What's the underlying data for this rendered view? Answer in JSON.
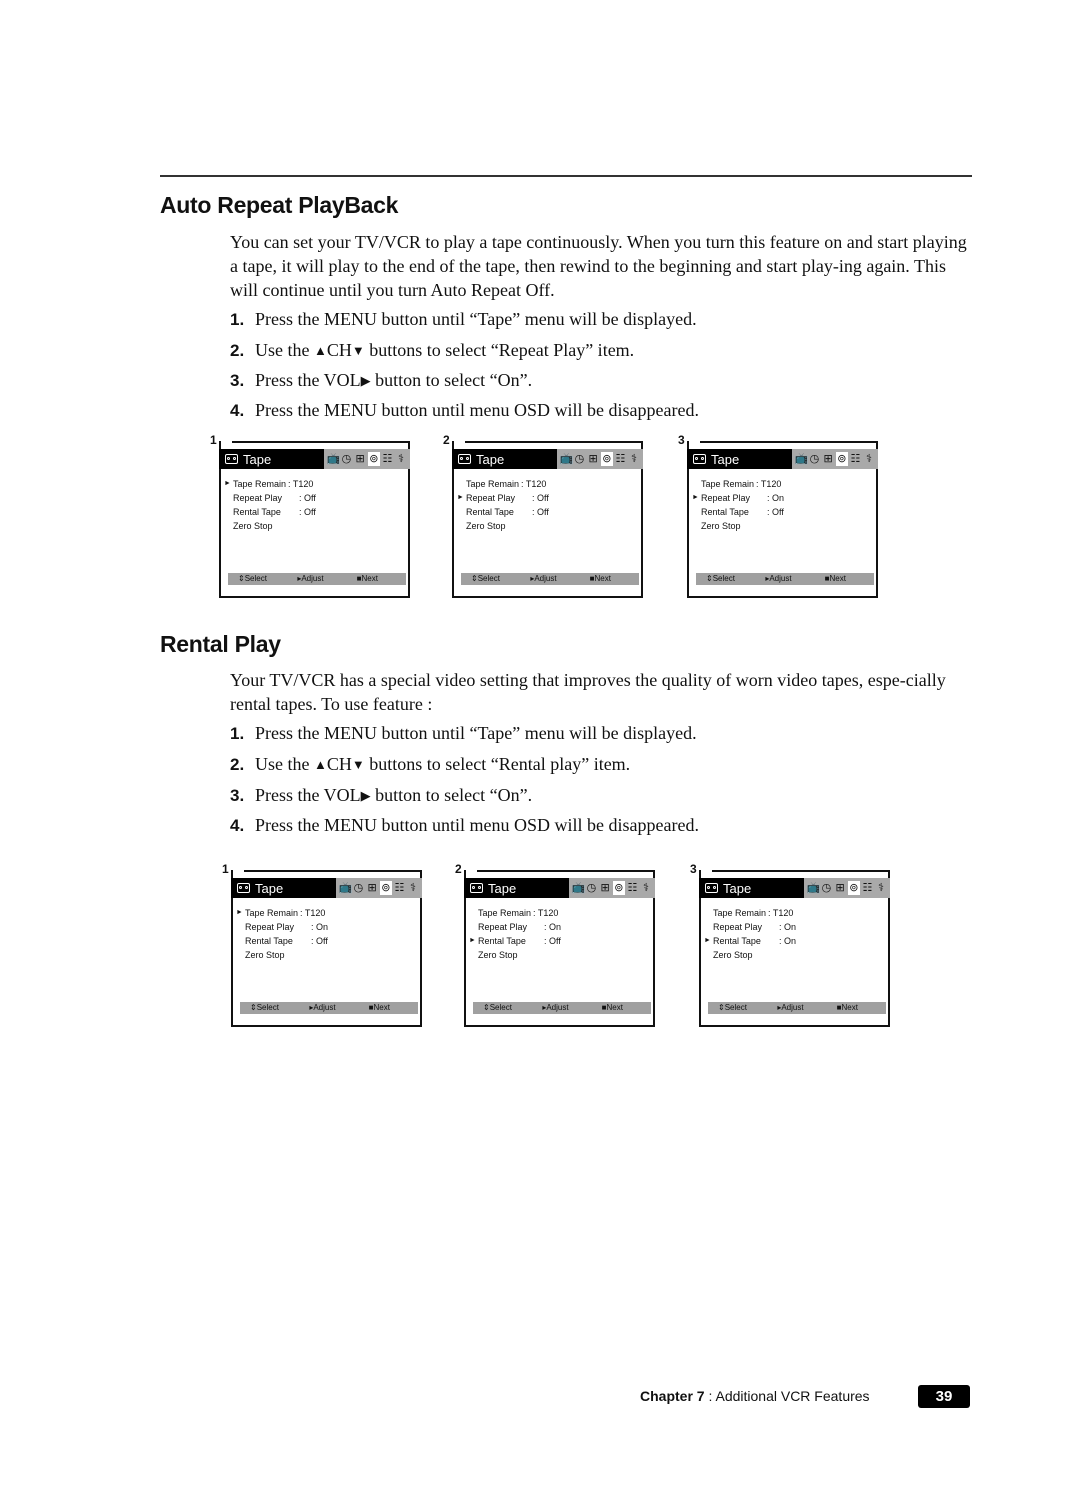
{
  "sections": [
    {
      "title": "Auto Repeat PlayBack",
      "intro": "You can set your TV/VCR to play a tape continuously. When you turn this feature on and start playing a tape, it will play to the end of the tape, then rewind to the beginning and start play-ing again. This will continue until you turn Auto Repeat Off.",
      "steps": [
        {
          "num": "1.",
          "pre": "Press the MENU button until “Tape” menu will be displayed.",
          "mid": "",
          "post": ""
        },
        {
          "num": "2.",
          "pre": "Use the ",
          "up": "▲",
          "mid": "CH",
          "down": "▼",
          "post": " buttons to select “Repeat Play” item."
        },
        {
          "num": "3.",
          "pre": "Press the VOL",
          "right": "▶",
          "post": " button to select “On”."
        },
        {
          "num": "4.",
          "pre": "Press the MENU button until menu OSD will be disappeared.",
          "mid": "",
          "post": ""
        }
      ],
      "screens": [
        {
          "label": "1",
          "selected": 0,
          "items": [
            [
              "Tape Remain",
              ": T120"
            ],
            [
              "Repeat Play",
              ": Off"
            ],
            [
              "Rental Tape",
              ": Off"
            ],
            [
              "Zero Stop",
              ""
            ]
          ]
        },
        {
          "label": "2",
          "selected": 1,
          "items": [
            [
              "Tape Remain",
              ": T120"
            ],
            [
              "Repeat Play",
              ": Off"
            ],
            [
              "Rental Tape",
              ": Off"
            ],
            [
              "Zero Stop",
              ""
            ]
          ]
        },
        {
          "label": "3",
          "selected": 1,
          "items": [
            [
              "Tape Remain",
              ": T120"
            ],
            [
              "Repeat Play",
              ": On"
            ],
            [
              "Rental Tape",
              ": Off"
            ],
            [
              "Zero Stop",
              ""
            ]
          ]
        }
      ]
    },
    {
      "title": "Rental Play",
      "intro": "Your TV/VCR has a special video setting that improves the quality of worn video tapes, espe-cially rental tapes. To use feature :",
      "steps": [
        {
          "num": "1.",
          "pre": "Press the MENU button until “Tape” menu will be displayed.",
          "mid": "",
          "post": ""
        },
        {
          "num": "2.",
          "pre": "Use the ",
          "up": "▲",
          "mid": "CH",
          "down": "▼",
          "post": " buttons to select “Rental play” item."
        },
        {
          "num": "3.",
          "pre": "Press the VOL",
          "right": "▶",
          "post": " button to select “On”."
        },
        {
          "num": "4.",
          "pre": "Press the MENU button until menu OSD will be disappeared.",
          "mid": "",
          "post": ""
        }
      ],
      "screens": [
        {
          "label": "1",
          "selected": 0,
          "items": [
            [
              "Tape Remain",
              ": T120"
            ],
            [
              "Repeat Play",
              ": On"
            ],
            [
              "Rental Tape",
              ": Off"
            ],
            [
              "Zero Stop",
              ""
            ]
          ]
        },
        {
          "label": "2",
          "selected": 2,
          "items": [
            [
              "Tape Remain",
              ": T120"
            ],
            [
              "Repeat Play",
              ": On"
            ],
            [
              "Rental Tape",
              ": Off"
            ],
            [
              "Zero Stop",
              ""
            ]
          ]
        },
        {
          "label": "3",
          "selected": 2,
          "items": [
            [
              "Tape Remain",
              ": T120"
            ],
            [
              "Repeat Play",
              ": On"
            ],
            [
              "Rental Tape",
              ": On"
            ],
            [
              "Zero Stop",
              ""
            ]
          ]
        }
      ]
    }
  ],
  "osd": {
    "menu_title": "Tape",
    "pointer": "►",
    "icons": [
      {
        "name": "tv-icon",
        "glyph": "📺",
        "text": "⌂"
      },
      {
        "name": "clock-icon",
        "glyph": "◷"
      },
      {
        "name": "gift-icon",
        "glyph": "⊞"
      },
      {
        "name": "tape-icon",
        "glyph": "⊚",
        "active": true
      },
      {
        "name": "setup-icon",
        "glyph": "☷"
      },
      {
        "name": "tool-icon",
        "glyph": "⚕"
      }
    ],
    "footer": {
      "select": "⇕Select",
      "adjust": "▸Adjust",
      "next": "■Next"
    }
  },
  "page_footer": {
    "chapter_bold": "Chapter 7",
    "chapter_rest": " : Additional VCR Features",
    "page_number": "39"
  }
}
